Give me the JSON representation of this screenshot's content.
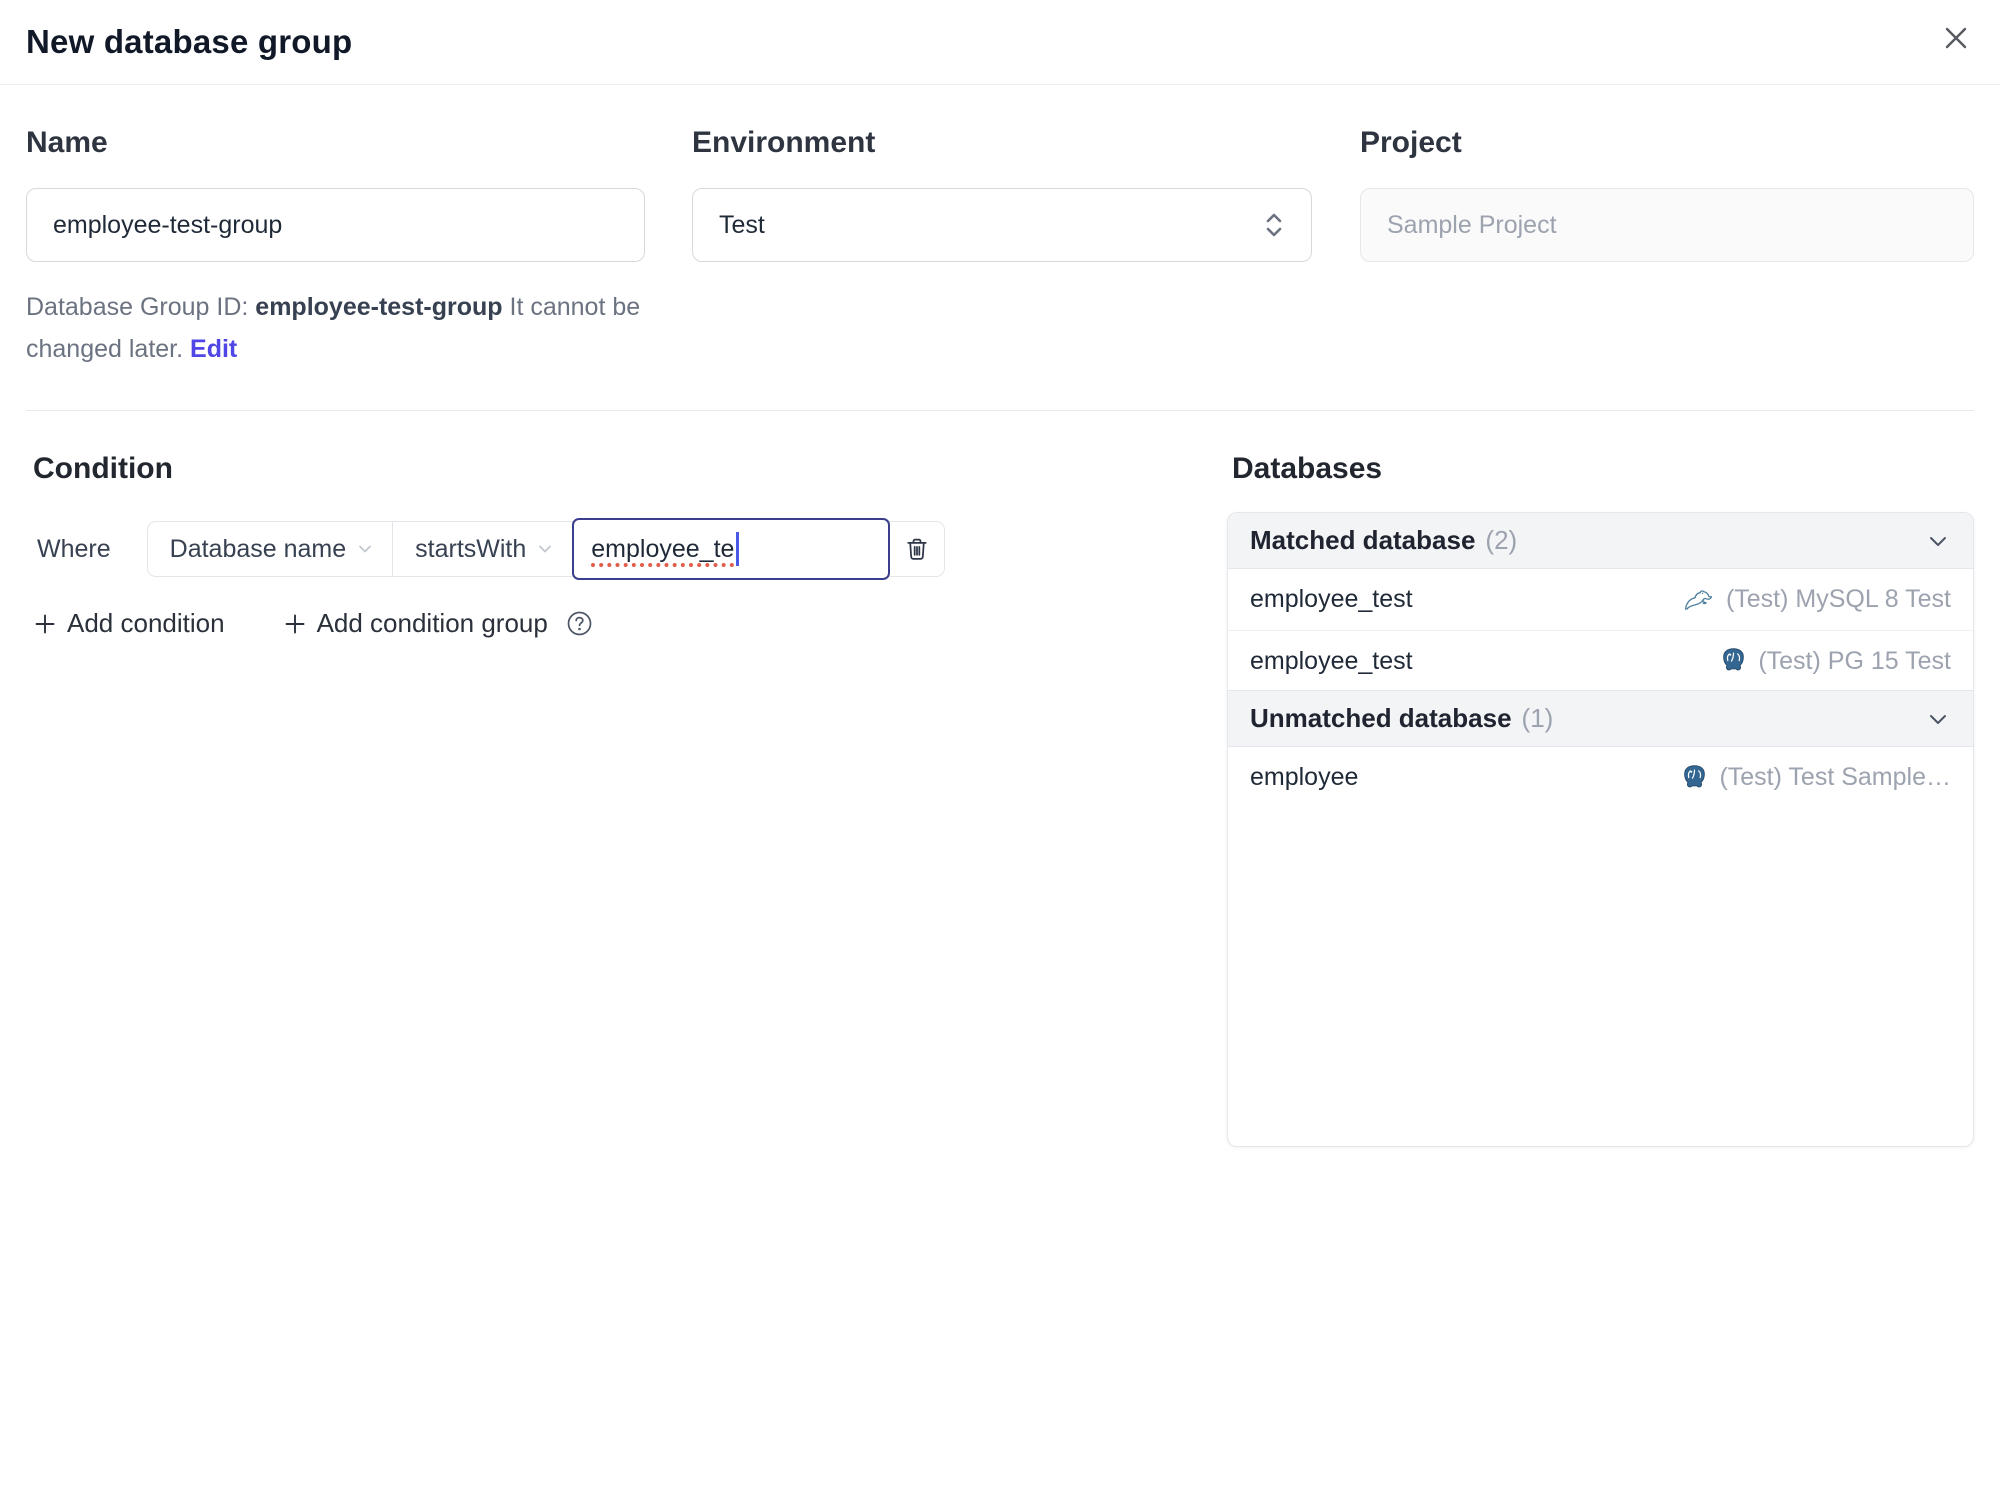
{
  "dialog": {
    "title": "New database group"
  },
  "form": {
    "name": {
      "label": "Name",
      "value": "employee-test-group"
    },
    "environment": {
      "label": "Environment",
      "value": "Test"
    },
    "project": {
      "label": "Project",
      "value": "Sample Project"
    },
    "id_hint": {
      "prefix": "Database Group ID: ",
      "id": "employee-test-group",
      "suffix": " It cannot be changed later. ",
      "edit_label": "Edit"
    }
  },
  "condition": {
    "section_label": "Condition",
    "where_label": "Where",
    "factor": "Database name",
    "operator": "startsWith",
    "value": "employee_te",
    "add_condition_label": "Add condition",
    "add_condition_group_label": "Add condition group"
  },
  "databases": {
    "section_label": "Databases",
    "matched": {
      "label": "Matched database",
      "count": "(2)",
      "rows": [
        {
          "name": "employee_test",
          "engine": "mysql",
          "instance": "(Test) MySQL 8 Test"
        },
        {
          "name": "employee_test",
          "engine": "postgresql",
          "instance": "(Test) PG 15 Test"
        }
      ]
    },
    "unmatched": {
      "label": "Unmatched database",
      "count": "(1)",
      "rows": [
        {
          "name": "employee",
          "engine": "postgresql",
          "instance": "(Test) Test Sample…"
        }
      ]
    }
  },
  "colors": {
    "accent": "#4f46e5",
    "focus_border": "#3b3e8c",
    "mysql_icon": "#4e7f9e",
    "postgresql_icon": "#336791",
    "muted_text": "#9ca3af",
    "header_bg": "#f3f4f6"
  }
}
